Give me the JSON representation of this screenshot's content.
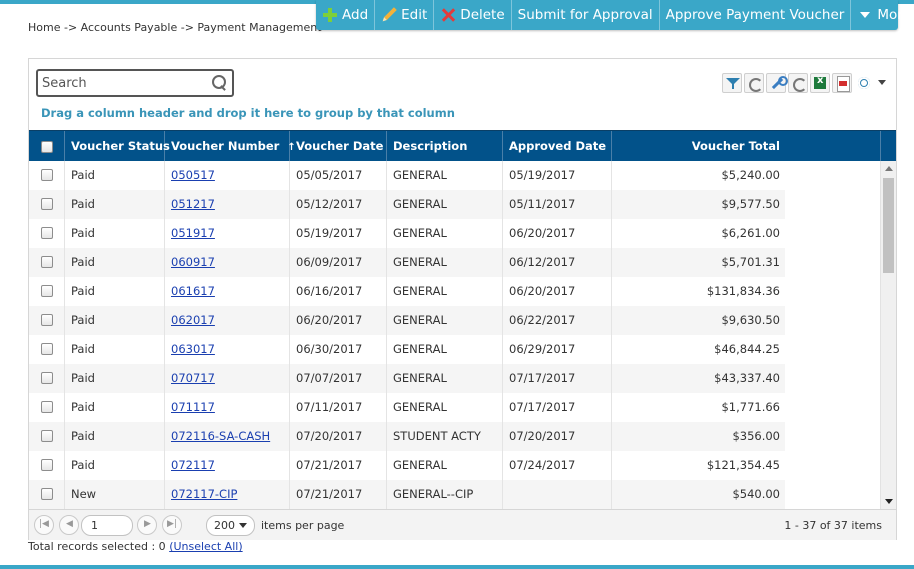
{
  "breadcrumb": "Home -> Accounts Payable -> Payment Management",
  "toolbar": {
    "add": "Add",
    "edit": "Edit",
    "delete": "Delete",
    "submit": "Submit for Approval",
    "approve": "Approve Payment Voucher",
    "more": "More"
  },
  "search": {
    "placeholder": "Search"
  },
  "group_hint": "Drag a column header and drop it here to group by that column",
  "columns": {
    "status": "Voucher Status",
    "number": "Voucher Number",
    "date": "Voucher Date",
    "description": "Description",
    "approved": "Approved Date",
    "total": "Voucher Total"
  },
  "sort_indicator": "↑",
  "rows": [
    {
      "status": "Paid",
      "number": "050517",
      "date": "05/05/2017",
      "description": "GENERAL",
      "approved": "05/19/2017",
      "total": "$5,240.00"
    },
    {
      "status": "Paid",
      "number": "051217",
      "date": "05/12/2017",
      "description": "GENERAL",
      "approved": "05/11/2017",
      "total": "$9,577.50"
    },
    {
      "status": "Paid",
      "number": "051917",
      "date": "05/19/2017",
      "description": "GENERAL",
      "approved": "06/20/2017",
      "total": "$6,261.00"
    },
    {
      "status": "Paid",
      "number": "060917",
      "date": "06/09/2017",
      "description": "GENERAL",
      "approved": "06/12/2017",
      "total": "$5,701.31"
    },
    {
      "status": "Paid",
      "number": "061617",
      "date": "06/16/2017",
      "description": "GENERAL",
      "approved": "06/20/2017",
      "total": "$131,834.36"
    },
    {
      "status": "Paid",
      "number": "062017",
      "date": "06/20/2017",
      "description": "GENERAL",
      "approved": "06/22/2017",
      "total": "$9,630.50"
    },
    {
      "status": "Paid",
      "number": "063017",
      "date": "06/30/2017",
      "description": "GENERAL",
      "approved": "06/29/2017",
      "total": "$46,844.25"
    },
    {
      "status": "Paid",
      "number": "070717",
      "date": "07/07/2017",
      "description": "GENERAL",
      "approved": "07/17/2017",
      "total": "$43,337.40"
    },
    {
      "status": "Paid",
      "number": "071117",
      "date": "07/11/2017",
      "description": "GENERAL",
      "approved": "07/17/2017",
      "total": "$1,771.66"
    },
    {
      "status": "Paid",
      "number": "072116-SA-CASH",
      "date": "07/20/2017",
      "description": "STUDENT ACTY",
      "approved": "07/20/2017",
      "total": "$356.00"
    },
    {
      "status": "Paid",
      "number": "072117",
      "date": "07/21/2017",
      "description": "GENERAL",
      "approved": "07/24/2017",
      "total": "$121,354.45"
    },
    {
      "status": "New",
      "number": "072117-CIP",
      "date": "07/21/2017",
      "description": "GENERAL--CIP",
      "approved": "",
      "total": "$540.00"
    }
  ],
  "pager": {
    "page": "1",
    "page_size": "200",
    "items_per_page": "items per page",
    "info": "1 - 37 of 37 items"
  },
  "selection": {
    "label": "Total records selected : 0",
    "unselect": "(Unselect All)"
  },
  "colors": {
    "accent": "#3aa7c8",
    "header": "#02528a",
    "link": "#1a3fb0",
    "hint": "#3a95b8"
  },
  "icons": [
    "plus-icon",
    "pencil-icon",
    "delete-x-icon",
    "caret-down-icon",
    "search-icon",
    "filter-icon",
    "refresh-icon",
    "wrench-icon",
    "excel-icon",
    "pdf-icon",
    "gear-icon"
  ]
}
